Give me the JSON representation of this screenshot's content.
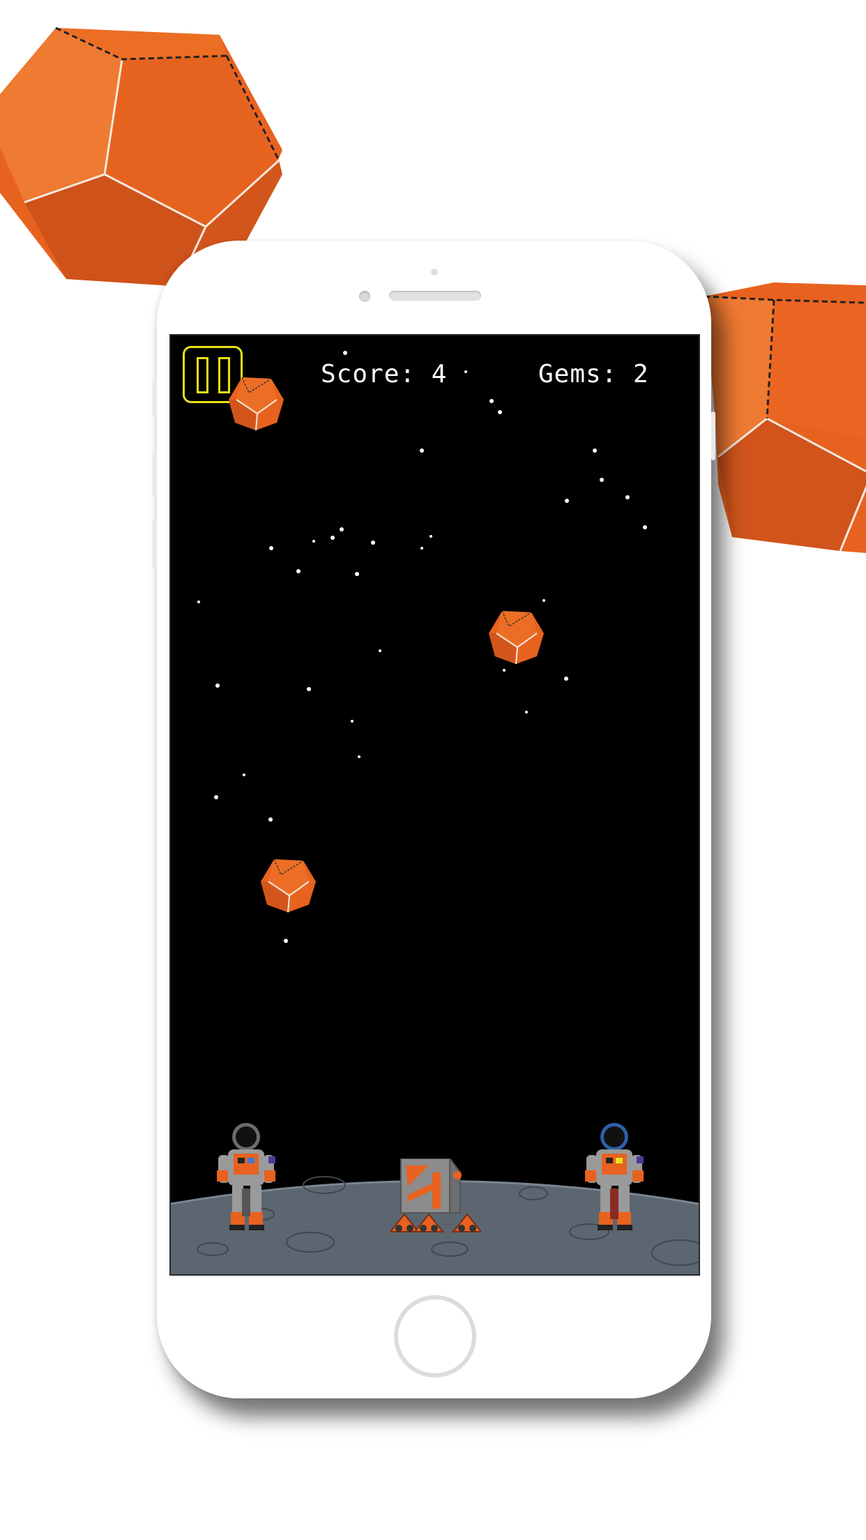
{
  "hud": {
    "score_text": "Score: 4",
    "gems_text": "Gems: 2"
  },
  "pause_button": {
    "icon": "pause-icon",
    "color": "#e9e11a"
  },
  "colors": {
    "gem_orange": "#e8621f",
    "gem_light": "#f07a30",
    "gem_dark": "#c8501a",
    "space": "#000000",
    "moon_surface": "#5c6670"
  },
  "icons": {
    "home": "home-button",
    "astronaut": "astronaut-icon",
    "rover": "rover-icon",
    "gem": "dodecahedron-gem-icon"
  }
}
